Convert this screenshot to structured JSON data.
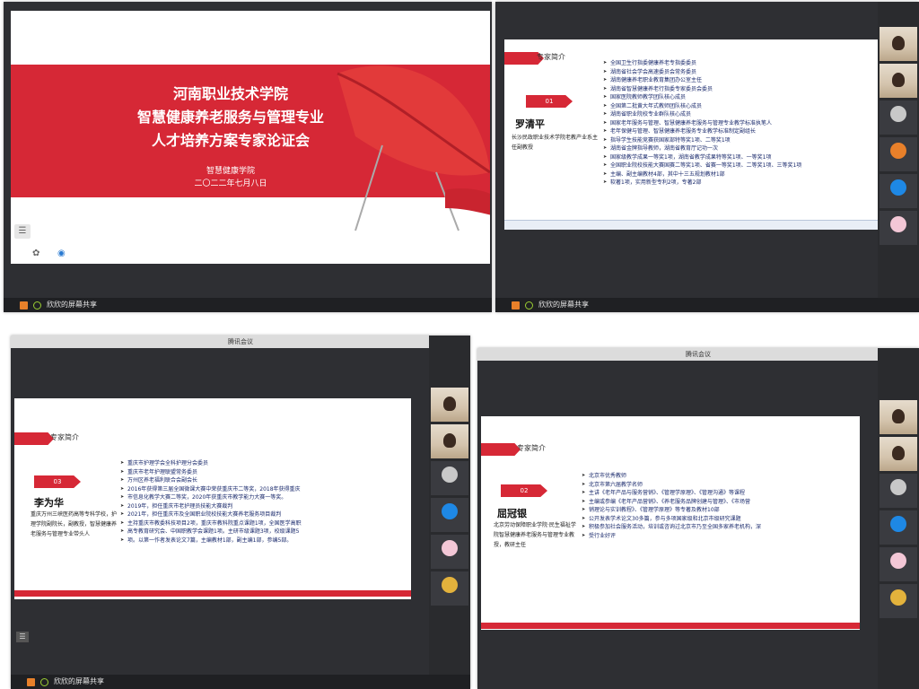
{
  "screenshots": {
    "s1": {
      "title_lines": [
        "河南职业技术学院",
        "智慧健康养老服务与管理专业",
        "人才培养方案专家论证会"
      ],
      "org": "智慧健康学院",
      "date": "二〇二二年七月八日",
      "share_label": "欣欣的屏幕共享"
    },
    "s2": {
      "header": "专家简介",
      "number": "01",
      "name": "罗清平",
      "affiliation": "长沙民政职业技术学院老教产业系主任副教授",
      "bullets": [
        "全国卫生行指委健康养老专指委委员",
        "湖南省社会学会高速委员会常务委员",
        "湖南健康养老职业教育集团办公室主任",
        "湖南省智慧健康养老行指委专家委员会委员",
        "国家医院教师教学团队核心成员",
        "全国第二批黄大年式教师团队核心成员",
        "湖南省职业院校专业群队核心成员",
        "国家老年服务与管理、智慧健康养老服务与管理专业教学标准执笔人",
        "老年保健与管理、智慧健康养老服务专业教学标准制定副组长",
        "指导学生技能竞赛获国家部特等奖1项、二等奖1项",
        "湖南省金牌指导教师，湖南省教育厅记功一次",
        "国家级教学成果一等奖1项，湖南省教学成果特等奖1项、一等奖1项",
        "全国职业院校技能大赛国赛二等奖1项、省赛一等奖1项、二等奖1项、三等奖1项",
        "主编、副主编教材4部，其中十三五规划教材1部",
        "软著1项，实用新型专利2项，专著2部"
      ],
      "share_label": "欣欣的屏幕共享"
    },
    "s3": {
      "window_title": "腾讯会议",
      "header": "专家简介",
      "number": "03",
      "name": "李为华",
      "affiliation": "重庆万州三峡医药高等专科学校，护理学院副院长，副教授，智慧健康养老服务与管理专业带头人",
      "bullets": [
        "重庆市护理学会全科护理分会委员",
        "重庆市老年护理联盟常务委员",
        "万州区养老福利联合会副会长",
        "2016年获得第三届全国微课大赛中荣获重庆市二等奖，2018年获得重庆",
        "市信息化教学大赛二等奖，2020年获重庆市教学能力大赛一等奖。",
        "2019年，担任重庆市老护理员技能大赛裁判",
        "2021年，担任重庆市及全国职业院校技能大赛养老服务项目裁判",
        "主持重庆市教委科技项目2项，重庆市教科院重点课题1项，全国医学高职",
        "高专教育研究会、中国职教学会课题1项。主研市级课题3项，校级课题5",
        "项。以第一作者发表论文7篇，主编教材1部，副主编1部，参编5部。"
      ],
      "share_label": "欣欣的屏幕共享"
    },
    "s4": {
      "window_title": "腾讯会议",
      "header": "专家简介",
      "number": "02",
      "name": "屈冠银",
      "affiliation": "北京劳动保障职业学院·民生福祉学院智慧健康养老服务与管理专业教授，教研主任",
      "bullets": [
        "北京市优秀教师",
        "北京市第六届教学名师",
        "主讲《老年产品与服务营销》、《管理学原理》、《管理沟通》等课程",
        "主编或参编《老年产品营销》、《养老服务品牌创建与管理》、《市场营",
        "销理论与实训教程》、《管理学原理》等专著及教材10部",
        "公开发表学术论文30多篇，参与多项国家级和北京市级研究课题",
        "积极参加社会服务活动，培训或咨询过北京市乃至全国多家养老机构，深",
        "受行业好评"
      ]
    }
  }
}
